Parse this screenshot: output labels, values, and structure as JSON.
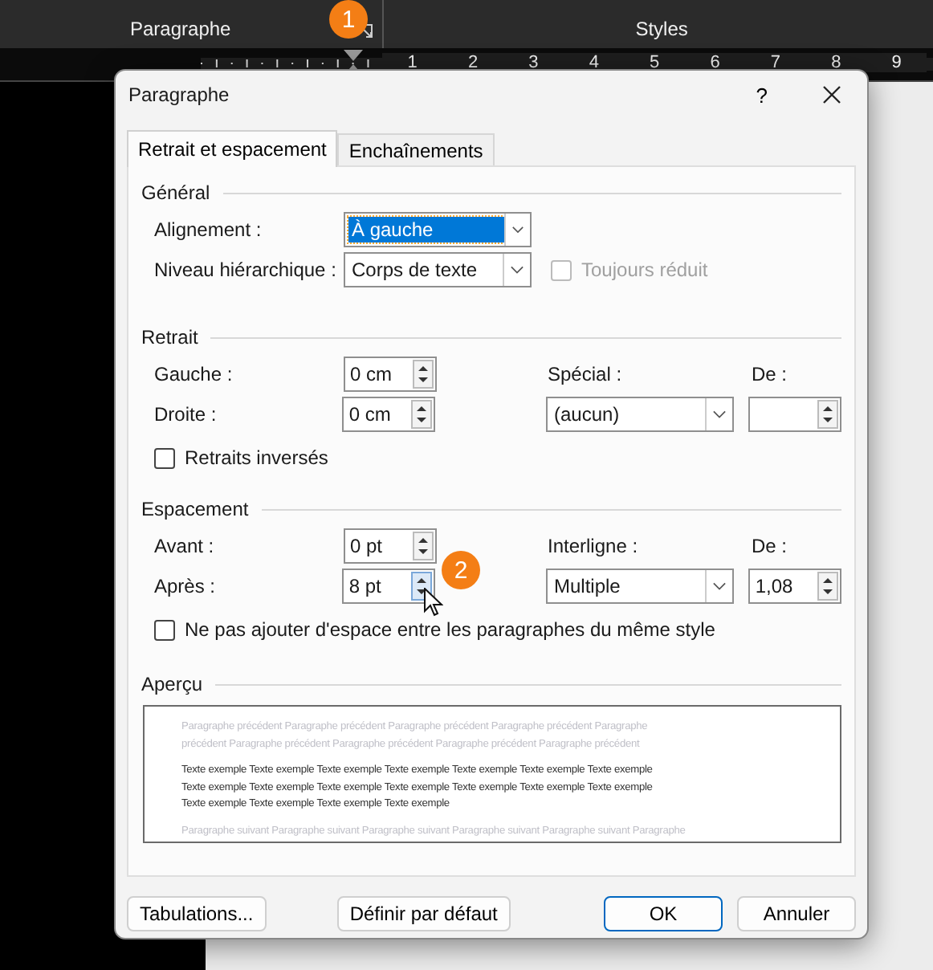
{
  "ribbon": {
    "groups": [
      {
        "label": "Paragraphe"
      },
      {
        "label": "Styles"
      }
    ]
  },
  "ruler": {
    "numbers": [
      "1",
      "2",
      "3",
      "4",
      "5",
      "6",
      "7",
      "8",
      "9"
    ]
  },
  "callouts": [
    {
      "label": "1"
    },
    {
      "label": "2"
    }
  ],
  "dialog": {
    "title": "Paragraphe",
    "help": "?",
    "tabs": [
      {
        "label": "Retrait et espacement",
        "selected": true
      },
      {
        "label": "Enchaînements",
        "selected": false
      }
    ],
    "general": {
      "heading": "Général",
      "alignment": {
        "label": "Alignement :",
        "value": "À gauche",
        "focused": true
      },
      "outline_level": {
        "label": "Niveau hiérarchique :",
        "value": "Corps de texte",
        "focused": false
      },
      "collapsed": {
        "label": "Toujours réduit",
        "checked": false,
        "disabled": true
      }
    },
    "indent": {
      "heading": "Retrait",
      "left": {
        "label": "Gauche :",
        "value": "0 cm"
      },
      "right": {
        "label": "Droite :",
        "value": "0 cm"
      },
      "special": {
        "label": "Spécial :",
        "value": "(aucun)",
        "focused": false
      },
      "by": {
        "label": "De :"
      },
      "mirror": {
        "label": "Retraits inversés",
        "checked": false,
        "disabled": false
      }
    },
    "spacing": {
      "heading": "Espacement",
      "before": {
        "label": "Avant :",
        "value": "0 pt"
      },
      "after": {
        "label": "Après :",
        "value": "8 pt"
      },
      "line_spacing": {
        "label": "Interligne :",
        "value": "Multiple",
        "focused": false
      },
      "at": {
        "label": "De :",
        "value": "1,08"
      },
      "dont_add": {
        "label": "Ne pas ajouter d'espace entre les paragraphes du même style",
        "checked": false,
        "disabled": false
      }
    },
    "preview": {
      "heading": "Aperçu",
      "previous_lines": [
        "Paragraphe précédent Paragraphe précédent Paragraphe précédent Paragraphe précédent Paragraphe",
        "précédent Paragraphe précédent Paragraphe précédent Paragraphe précédent Paragraphe précédent"
      ],
      "sample_lines": [
        "Texte exemple Texte exemple Texte exemple Texte exemple Texte exemple Texte exemple Texte exemple",
        "Texte exemple Texte exemple Texte exemple Texte exemple Texte exemple Texte exemple Texte exemple",
        "Texte exemple Texte exemple Texte exemple Texte exemple"
      ],
      "next_lines": [
        "Paragraphe suivant Paragraphe suivant Paragraphe suivant Paragraphe suivant Paragraphe suivant Paragraphe"
      ]
    },
    "buttons": [
      {
        "label": "Tabulations...",
        "kind": "left",
        "default": false
      },
      {
        "label": "Définir par défaut",
        "kind": "center",
        "default": false
      },
      {
        "label": "OK",
        "kind": "right",
        "default": true
      },
      {
        "label": "Annuler",
        "kind": "right",
        "default": false
      }
    ]
  }
}
